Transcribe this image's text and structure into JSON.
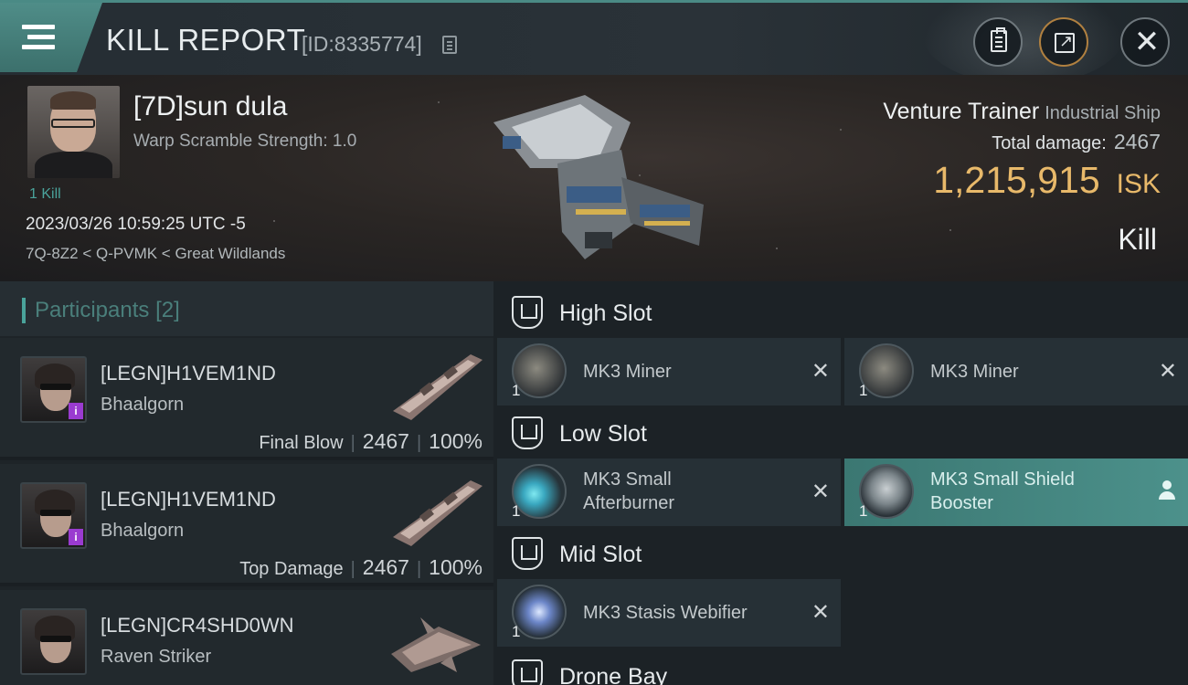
{
  "header": {
    "title": "KILL REPORT",
    "report_id": "[ID:8335774]",
    "icons": [
      "menu-icon",
      "copy-icon",
      "clipboard-icon",
      "share-icon",
      "close-icon"
    ]
  },
  "victim": {
    "name": "[7D]sun dula",
    "warp_scramble": "Warp Scramble Strength: 1.0",
    "kills": "1 Kill",
    "datetime": "2023/03/26 10:59:25 UTC -5",
    "location": "7Q-8Z2 < Q-PVMK < Great Wildlands"
  },
  "ship": {
    "name": "Venture Trainer",
    "class": "Industrial Ship",
    "total_damage_label": "Total damage:",
    "total_damage": "2467",
    "isk_value": "1,215,915",
    "isk_unit": "ISK",
    "result": "Kill"
  },
  "participants": {
    "header": "Participants",
    "count": "[2]",
    "rows": [
      {
        "name": "[LEGN]H1VEM1ND",
        "ship": "Bhaalgorn",
        "role": "Final Blow",
        "damage": "2467",
        "percent": "100%",
        "badge": "i"
      },
      {
        "name": "[LEGN]H1VEM1ND",
        "ship": "Bhaalgorn",
        "role": "Top Damage",
        "damage": "2467",
        "percent": "100%",
        "badge": "i"
      },
      {
        "name": "[LEGN]CR4SHD0WN",
        "ship": "Raven Striker"
      }
    ]
  },
  "fitting": {
    "high_slot": "High Slot",
    "low_slot": "Low Slot",
    "mid_slot": "Mid Slot",
    "drone_bay": "Drone Bay",
    "high_modules": [
      {
        "qty": "1",
        "name_line1": "MK3 Miner",
        "name_line2": "",
        "mark": "✕"
      },
      {
        "qty": "1",
        "name_line1": "MK3 Miner",
        "name_line2": "",
        "mark": "✕"
      }
    ],
    "low_modules": [
      {
        "qty": "1",
        "name_line1": "MK3 Small",
        "name_line2": "Afterburner",
        "mark": "✕"
      },
      {
        "qty": "1",
        "name_line1": "MK3 Small Shield",
        "name_line2": "Booster"
      }
    ],
    "mid_modules": [
      {
        "qty": "1",
        "name_line1": "MK3 Stasis Webifier",
        "name_line2": "",
        "mark": "✕"
      }
    ]
  },
  "colors": {
    "accent": "#4aa39b",
    "isk": "#e8b96a",
    "badge": "#9a3bd0"
  }
}
